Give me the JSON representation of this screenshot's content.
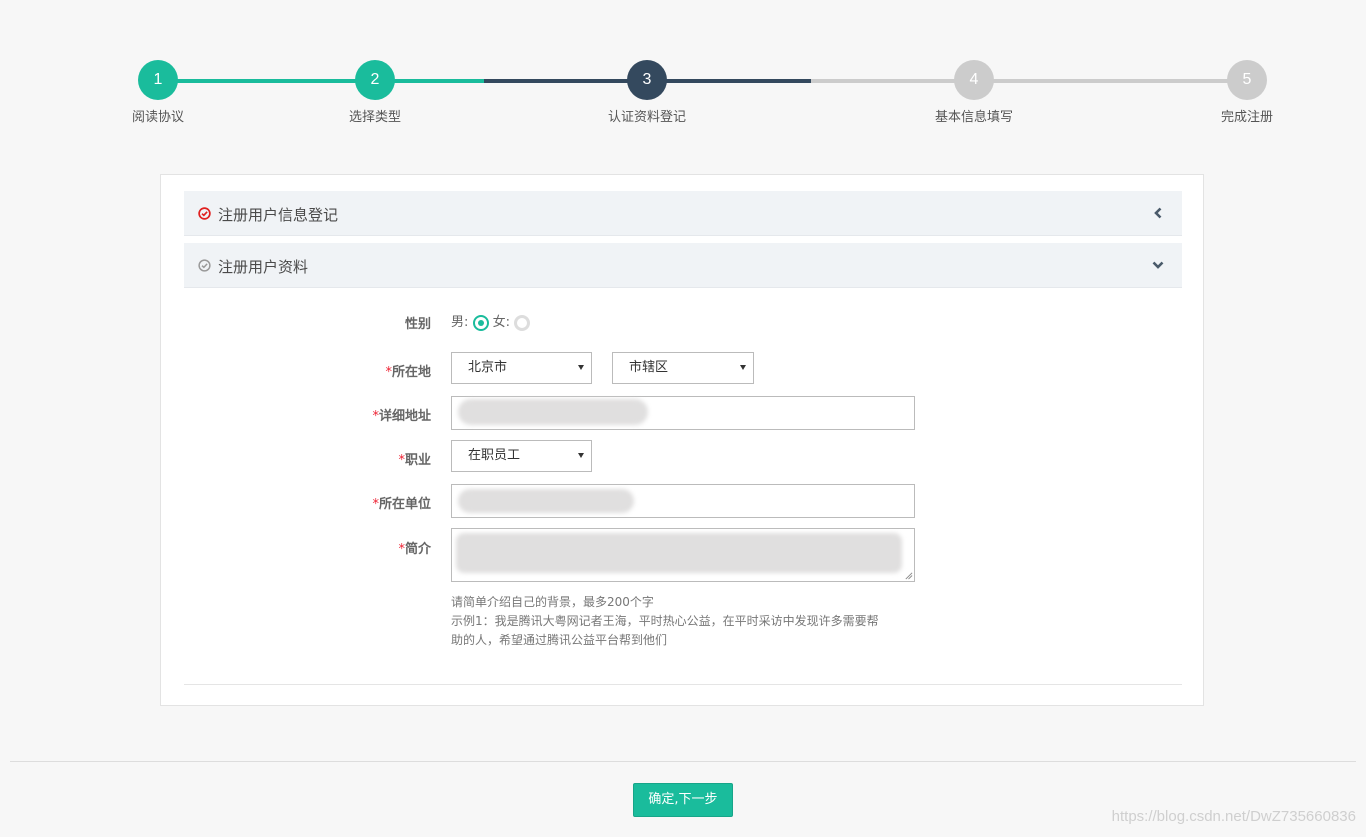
{
  "steps": [
    {
      "number": "1",
      "label": "阅读协议",
      "state": "done"
    },
    {
      "number": "2",
      "label": "选择类型",
      "state": "done"
    },
    {
      "number": "3",
      "label": "认证资料登记",
      "state": "current"
    },
    {
      "number": "4",
      "label": "基本信息填写",
      "state": "todo"
    },
    {
      "number": "5",
      "label": "完成注册",
      "state": "todo"
    }
  ],
  "colors": {
    "done": "#1abc9c",
    "current": "#34495e",
    "todo": "#cccccc",
    "error": "#e02020"
  },
  "panels": {
    "registration_info": {
      "title": "注册用户信息登记",
      "icon": "check-circle-icon",
      "chevron": "chevron-left-icon"
    },
    "profile": {
      "title": "注册用户资料",
      "icon": "check-circle-icon",
      "chevron": "chevron-down-icon"
    }
  },
  "form": {
    "gender": {
      "label": "性别",
      "male_label": "男:",
      "female_label": "女:",
      "selected": "male"
    },
    "location": {
      "label": "所在地",
      "required_mark": "*",
      "province": "北京市",
      "district": "市辖区"
    },
    "address": {
      "label": "详细地址",
      "required_mark": "*"
    },
    "occupation": {
      "label": "职业",
      "required_mark": "*",
      "value": "在职员工"
    },
    "employer": {
      "label": "所在单位",
      "required_mark": "*"
    },
    "intro": {
      "label": "简介",
      "required_mark": "*",
      "hint_line1": "请简单介绍自己的背景，最多200个字",
      "hint_line2": "示例1：我是腾讯大粤网记者王海，平时热心公益，在平时采访中发现许多需要帮",
      "hint_line3": "助的人，希望通过腾讯公益平台帮到他们"
    }
  },
  "actions": {
    "next_label": "确定,下一步"
  },
  "watermark": "https://blog.csdn.net/DwZ735660836"
}
